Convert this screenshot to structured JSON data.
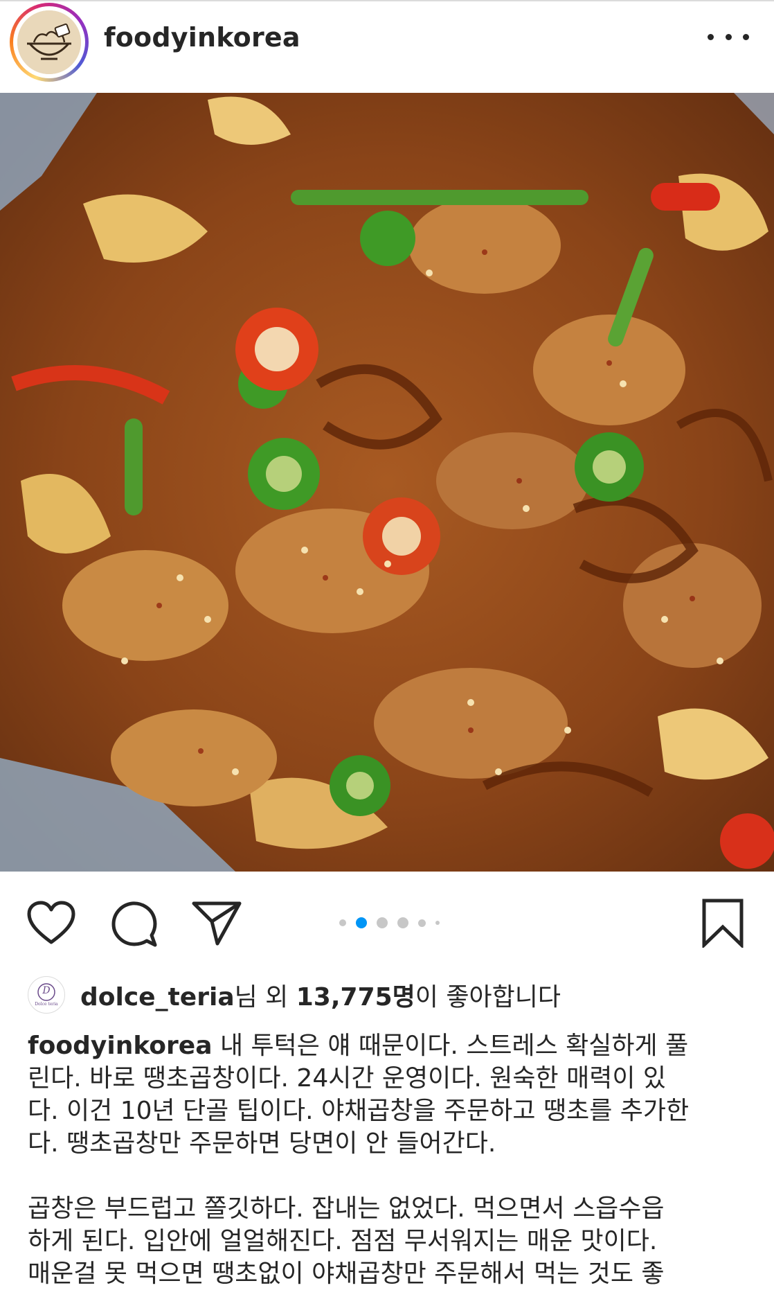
{
  "post": {
    "username": "foodyinkorea",
    "more_icon": "more-horizontal-icon"
  },
  "actions": {
    "like_icon": "heart-icon",
    "comment_icon": "comment-bubble-icon",
    "share_icon": "paper-plane-icon",
    "save_icon": "bookmark-icon",
    "carousel_total": 6,
    "carousel_active_index": 2,
    "accent_color": "#0095f6"
  },
  "likes": {
    "liker": "dolce_teria",
    "liker_suffix": "님 외 ",
    "count": "13,775명",
    "tail": "이 좋아합니다",
    "liker_avatar_text": "D",
    "liker_avatar_sub": "Dolce teria"
  },
  "caption": {
    "username": "foodyinkorea",
    "line1": " 내 투턱은 얘 때문이다. 스트레스 확실하게 풀",
    "line2": "린다. 바로 땡초곱창이다. 24시간 운영이다. 원숙한 매력이 있",
    "line3": "다. 이건 10년 단골 팁이다. 야채곱창을 주문하고 땡초를 추가한",
    "line4": "다. 땡초곱창만 주문하면 당면이 안 들어간다.",
    "p2_line1": "곱창은 부드럽고 쫄깃하다. 잡내는 없었다. 먹으면서 스읍수읍",
    "p2_line2": "하게 된다. 입안에 얼얼해진다. 점점 무서워지는 매운 맛이다.",
    "p2_line3": "매운걸 못 먹으면 땡초없이 야채곱창만 주문해서 먹는 것도 좋"
  }
}
